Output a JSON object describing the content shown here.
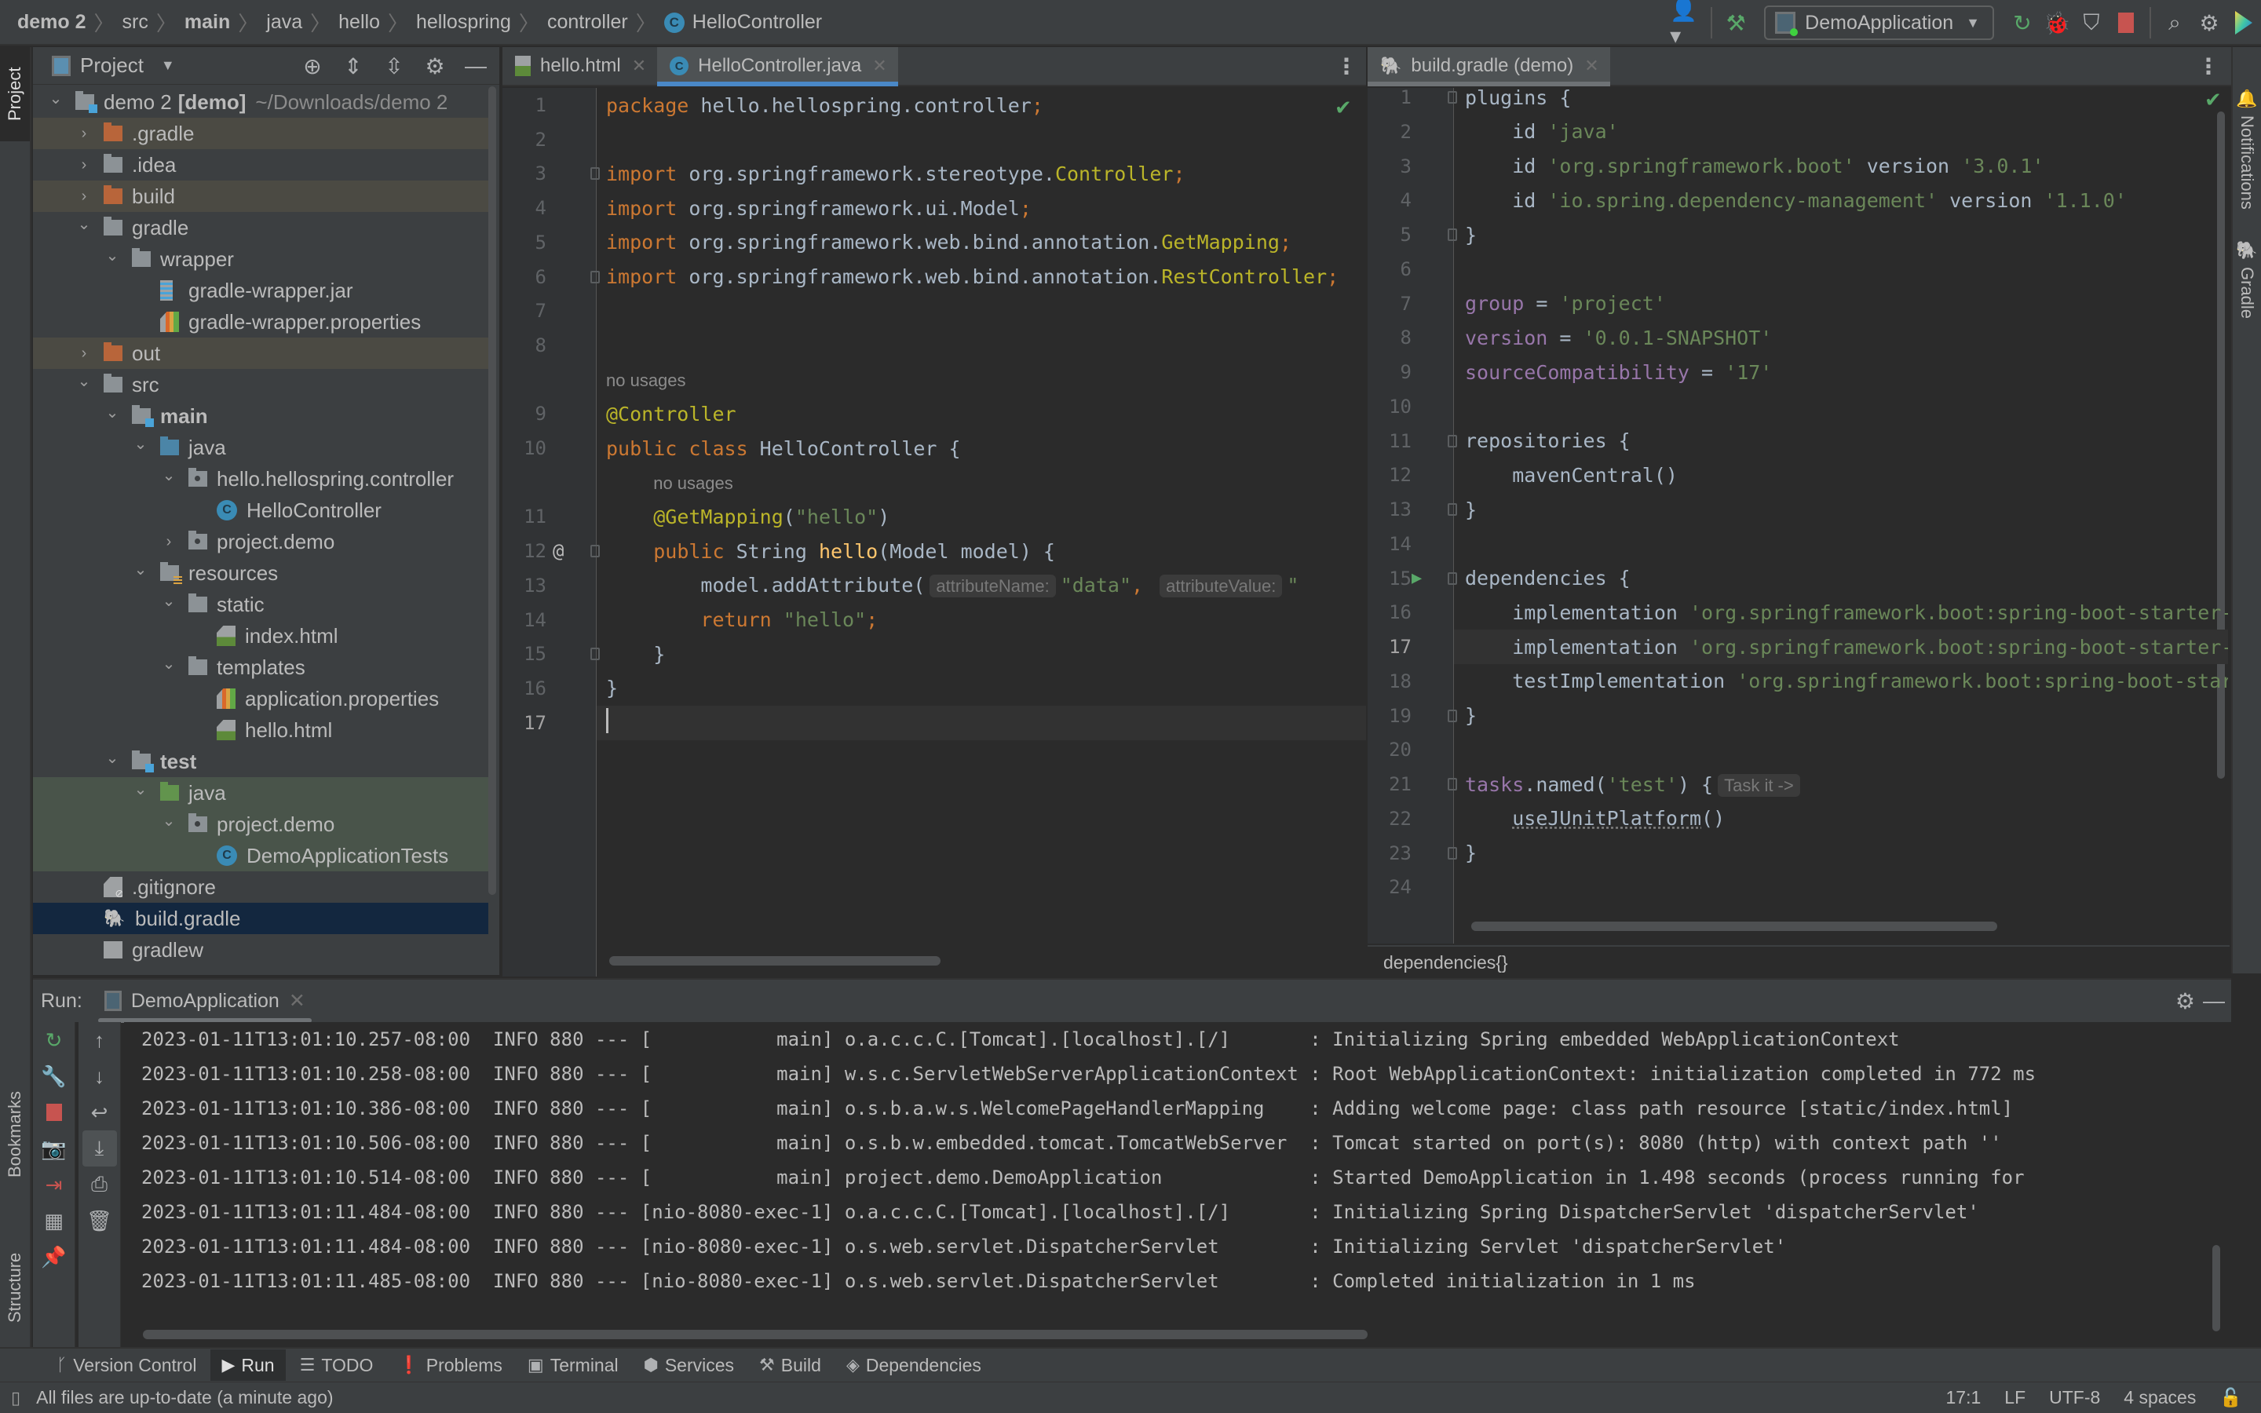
{
  "navbar": {
    "breadcrumbs": [
      {
        "label": "demo 2",
        "bold": true
      },
      {
        "label": "src",
        "bold": false
      },
      {
        "label": "main",
        "bold": true
      },
      {
        "label": "java",
        "bold": false
      },
      {
        "label": "hello",
        "bold": false
      },
      {
        "label": "hellospring",
        "bold": false
      },
      {
        "label": "controller",
        "bold": false
      }
    ],
    "current_file": "HelloController",
    "class_badge": "C",
    "run_configuration": "DemoApplication",
    "icons": [
      "user-icon",
      "build-hammer-icon",
      "rerun-icon",
      "debug-icon",
      "coverage-icon",
      "stop-icon",
      "search-icon",
      "settings-icon",
      "toolbox-icon"
    ]
  },
  "left_stripe": {
    "project_tab": "Project",
    "bookmarks_tab": "Bookmarks",
    "structure_tab": "Structure"
  },
  "project_panel": {
    "title": "Project",
    "tree": [
      {
        "label": "demo 2",
        "suffix": "[demo]",
        "path": "~/Downloads/demo 2",
        "depth": 0,
        "expand": "open",
        "icon": "module",
        "style": ""
      },
      {
        "label": ".gradle",
        "depth": 1,
        "expand": "closed",
        "icon": "folder-orange",
        "style": "excluded"
      },
      {
        "label": ".idea",
        "depth": 1,
        "expand": "closed",
        "icon": "folder-gray",
        "style": ""
      },
      {
        "label": "build",
        "depth": 1,
        "expand": "closed",
        "icon": "folder-orange",
        "style": "excluded"
      },
      {
        "label": "gradle",
        "depth": 1,
        "expand": "open",
        "icon": "folder-gray",
        "style": ""
      },
      {
        "label": "wrapper",
        "depth": 2,
        "expand": "open",
        "icon": "folder-gray",
        "style": ""
      },
      {
        "label": "gradle-wrapper.jar",
        "depth": 3,
        "expand": "none",
        "icon": "jar",
        "style": ""
      },
      {
        "label": "gradle-wrapper.properties",
        "depth": 3,
        "expand": "none",
        "icon": "props",
        "style": ""
      },
      {
        "label": "out",
        "depth": 1,
        "expand": "closed",
        "icon": "folder-orange",
        "style": "excluded"
      },
      {
        "label": "src",
        "depth": 1,
        "expand": "open",
        "icon": "folder-gray",
        "style": ""
      },
      {
        "label": "main",
        "depth": 2,
        "expand": "open",
        "icon": "folder-src",
        "style": "",
        "bold": true
      },
      {
        "label": "java",
        "depth": 3,
        "expand": "open",
        "icon": "folder-blue",
        "style": ""
      },
      {
        "label": "hello.hellospring.controller",
        "depth": 4,
        "expand": "open",
        "icon": "package",
        "style": ""
      },
      {
        "label": "HelloController",
        "depth": 5,
        "expand": "none",
        "icon": "class",
        "style": ""
      },
      {
        "label": "project.demo",
        "depth": 4,
        "expand": "closed",
        "icon": "package",
        "style": ""
      },
      {
        "label": "resources",
        "depth": 3,
        "expand": "open",
        "icon": "folder-res",
        "style": ""
      },
      {
        "label": "static",
        "depth": 4,
        "expand": "open",
        "icon": "folder-gray",
        "style": ""
      },
      {
        "label": "index.html",
        "depth": 5,
        "expand": "none",
        "icon": "html",
        "style": ""
      },
      {
        "label": "templates",
        "depth": 4,
        "expand": "open",
        "icon": "folder-gray",
        "style": ""
      },
      {
        "label": "application.properties",
        "depth": 5,
        "expand": "none",
        "icon": "props",
        "style": ""
      },
      {
        "label": "hello.html",
        "depth": 5,
        "expand": "none",
        "icon": "html",
        "style": ""
      },
      {
        "label": "test",
        "depth": 2,
        "expand": "open",
        "icon": "folder-src",
        "style": "",
        "bold": true
      },
      {
        "label": "java",
        "depth": 3,
        "expand": "open",
        "icon": "folder-green",
        "style": "test"
      },
      {
        "label": "project.demo",
        "depth": 4,
        "expand": "open",
        "icon": "package",
        "style": "test"
      },
      {
        "label": "DemoApplicationTests",
        "depth": 5,
        "expand": "none",
        "icon": "class",
        "style": "test"
      },
      {
        "label": ".gitignore",
        "depth": 1,
        "expand": "none",
        "icon": "git",
        "style": ""
      },
      {
        "label": "build.gradle",
        "depth": 1,
        "expand": "none",
        "icon": "gradle",
        "style": "selected"
      },
      {
        "label": "gradlew",
        "depth": 1,
        "expand": "none",
        "icon": "script",
        "style": ""
      }
    ]
  },
  "left_editor": {
    "tabs": [
      {
        "label": "hello.html",
        "icon": "html",
        "active": false
      },
      {
        "label": "HelloController.java",
        "icon": "class",
        "active": true
      }
    ],
    "current_line": 17,
    "lines": [
      {
        "n": "1",
        "html": "<span class='kw'>package</span> hello.hellospring.controller<span class='kw'>;</span>"
      },
      {
        "n": "2",
        "html": ""
      },
      {
        "n": "3",
        "html": "<span class='kw'>import</span> org.springframework.stereotype.<span class='ann'>Controller</span><span class='kw'>;</span>",
        "fold": "open"
      },
      {
        "n": "4",
        "html": "<span class='kw'>import</span> org.springframework.ui.Model<span class='kw'>;</span>"
      },
      {
        "n": "5",
        "html": "<span class='kw'>import</span> org.springframework.web.bind.annotation.<span class='ann'>GetMapping</span><span class='kw'>;</span>"
      },
      {
        "n": "6",
        "html": "<span class='kw'>import</span> org.springframework.web.bind.annotation.<span class='ann'>RestController</span><span class='kw'>;</span>",
        "fold": "close"
      },
      {
        "n": "7",
        "html": ""
      },
      {
        "n": "8",
        "html": ""
      },
      {
        "n": "",
        "html": "<span class='usage'>no usages</span>"
      },
      {
        "n": "9",
        "html": "<span class='ann'>@Controller</span>"
      },
      {
        "n": "10",
        "html": "<span class='kw'>public class</span> HelloController {"
      },
      {
        "n": "",
        "html": "    <span class='usage'>no usages</span>"
      },
      {
        "n": "11",
        "html": "    <span class='ann'>@GetMapping</span>(<span class='str'>\"hello\"</span>)"
      },
      {
        "n": "12",
        "html": "    <span class='kw'>public</span> String <span class='fn'>hello</span>(Model model) {",
        "fold": "open",
        "marker": "@"
      },
      {
        "n": "13",
        "html": "        model.addAttribute(<span class='hint'>attributeName:</span><span class='str'>\"data\"</span><span class='kw'>,</span> <span class='hint'>attributeValue:</span><span class='str'>\"</span>"
      },
      {
        "n": "14",
        "html": "        <span class='kw'>return</span> <span class='str'>\"hello\"</span><span class='kw'>;</span>"
      },
      {
        "n": "15",
        "html": "    }",
        "fold": "close"
      },
      {
        "n": "16",
        "html": "}"
      },
      {
        "n": "17",
        "html": "<span class='caret'></span>",
        "current": true
      }
    ]
  },
  "right_editor": {
    "tabs": [
      {
        "label": "build.gradle (demo)",
        "icon": "gradle",
        "active": true
      }
    ],
    "current_line": 17,
    "lines": [
      {
        "n": "1",
        "html": "plugins {",
        "fold": "open"
      },
      {
        "n": "2",
        "html": "    id <span class='str'>'java'</span>"
      },
      {
        "n": "3",
        "html": "    id <span class='str'>'org.springframework.boot'</span> version <span class='str'>'3.0.1'</span>"
      },
      {
        "n": "4",
        "html": "    id <span class='str'>'io.spring.dependency-management'</span> version <span class='str'>'1.1.0'</span>"
      },
      {
        "n": "5",
        "html": "}",
        "fold": "close"
      },
      {
        "n": "6",
        "html": ""
      },
      {
        "n": "7",
        "html": "<span class='prop'>group</span> = <span class='str'>'project'</span>"
      },
      {
        "n": "8",
        "html": "<span class='prop'>version</span> = <span class='str'>'0.0.1-SNAPSHOT'</span>"
      },
      {
        "n": "9",
        "html": "<span class='prop'>sourceCompatibility</span> = <span class='str'>'17'</span>"
      },
      {
        "n": "10",
        "html": ""
      },
      {
        "n": "11",
        "html": "repositories {",
        "fold": "open"
      },
      {
        "n": "12",
        "html": "    mavenCentral()"
      },
      {
        "n": "13",
        "html": "}",
        "fold": "close"
      },
      {
        "n": "14",
        "html": ""
      },
      {
        "n": "15",
        "html": "dependencies {",
        "fold": "open",
        "marker": "run"
      },
      {
        "n": "16",
        "html": "    implementation <span class='str'>'org.springframework.boot:spring-boot-starter-thymeleaf'</span>"
      },
      {
        "n": "17",
        "html": "    implementation <span class='str'>'org.springframework.boot:spring-boot-starter-web'</span>",
        "current": true
      },
      {
        "n": "18",
        "html": "    testImplementation <span class='str'>'org.springframework.boot:spring-boot-starter-test'</span>"
      },
      {
        "n": "19",
        "html": "}",
        "fold": "close"
      },
      {
        "n": "20",
        "html": ""
      },
      {
        "n": "21",
        "html": "<span class='prop'>tasks</span>.named(<span class='str'>'test'</span>) {<span class='hint'>Task it -&gt;</span>",
        "fold": "open"
      },
      {
        "n": "22",
        "html": "    <span class='dotted'>useJUnitPlatform</span>()"
      },
      {
        "n": "23",
        "html": "}",
        "fold": "close"
      },
      {
        "n": "24",
        "html": ""
      }
    ],
    "breadcrumb": "dependencies{}"
  },
  "right_stripe": {
    "notifications_tab": "Notifications",
    "gradle_tab": "Gradle"
  },
  "run_panel": {
    "label": "Run:",
    "tab": "DemoApplication",
    "log": [
      {
        "ts": "2023-01-11T13:01:10.257-08:00",
        "level": "INFO",
        "pid": "880",
        "thread": "           main",
        "logger": "o.a.c.c.C.[Tomcat].[localhost].[/]      ",
        "msg": "Initializing Spring embedded WebApplicationContext"
      },
      {
        "ts": "2023-01-11T13:01:10.258-08:00",
        "level": "INFO",
        "pid": "880",
        "thread": "           main",
        "logger": "w.s.c.ServletWebServerApplicationContext",
        "msg": "Root WebApplicationContext: initialization completed in 772 ms"
      },
      {
        "ts": "2023-01-11T13:01:10.386-08:00",
        "level": "INFO",
        "pid": "880",
        "thread": "           main",
        "logger": "o.s.b.a.w.s.WelcomePageHandlerMapping   ",
        "msg": "Adding welcome page: class path resource [static/index.html]"
      },
      {
        "ts": "2023-01-11T13:01:10.506-08:00",
        "level": "INFO",
        "pid": "880",
        "thread": "           main",
        "logger": "o.s.b.w.embedded.tomcat.TomcatWebServer ",
        "msg": "Tomcat started on port(s): 8080 (http) with context path ''"
      },
      {
        "ts": "2023-01-11T13:01:10.514-08:00",
        "level": "INFO",
        "pid": "880",
        "thread": "           main",
        "logger": "project.demo.DemoApplication            ",
        "msg": "Started DemoApplication in 1.498 seconds (process running for"
      },
      {
        "ts": "2023-01-11T13:01:11.484-08:00",
        "level": "INFO",
        "pid": "880",
        "thread": "nio-8080-exec-1",
        "logger": "o.a.c.c.C.[Tomcat].[localhost].[/]      ",
        "msg": "Initializing Spring DispatcherServlet 'dispatcherServlet'"
      },
      {
        "ts": "2023-01-11T13:01:11.484-08:00",
        "level": "INFO",
        "pid": "880",
        "thread": "nio-8080-exec-1",
        "logger": "o.s.web.servlet.DispatcherServlet       ",
        "msg": "Initializing Servlet 'dispatcherServlet'"
      },
      {
        "ts": "2023-01-11T13:01:11.485-08:00",
        "level": "INFO",
        "pid": "880",
        "thread": "nio-8080-exec-1",
        "logger": "o.s.web.servlet.DispatcherServlet       ",
        "msg": "Completed initialization in 1 ms"
      }
    ]
  },
  "tool_windows": [
    {
      "label": "Version Control",
      "icon": "ᚴ",
      "name": "version-control",
      "active": false
    },
    {
      "label": "Run",
      "icon": "▶",
      "name": "run",
      "active": true
    },
    {
      "label": "TODO",
      "icon": "☰",
      "name": "todo",
      "active": false
    },
    {
      "label": "Problems",
      "icon": "❗",
      "name": "problems",
      "active": false
    },
    {
      "label": "Terminal",
      "icon": "▣",
      "name": "terminal",
      "active": false
    },
    {
      "label": "Services",
      "icon": "⬢",
      "name": "services",
      "active": false
    },
    {
      "label": "Build",
      "icon": "⚒",
      "name": "build",
      "active": false
    },
    {
      "label": "Dependencies",
      "icon": "◈",
      "name": "dependencies",
      "active": false
    }
  ],
  "status_bar": {
    "message": "All files are up-to-date (a minute ago)",
    "position": "17:1",
    "line_separator": "LF",
    "encoding": "UTF-8",
    "indent": "4 spaces"
  }
}
